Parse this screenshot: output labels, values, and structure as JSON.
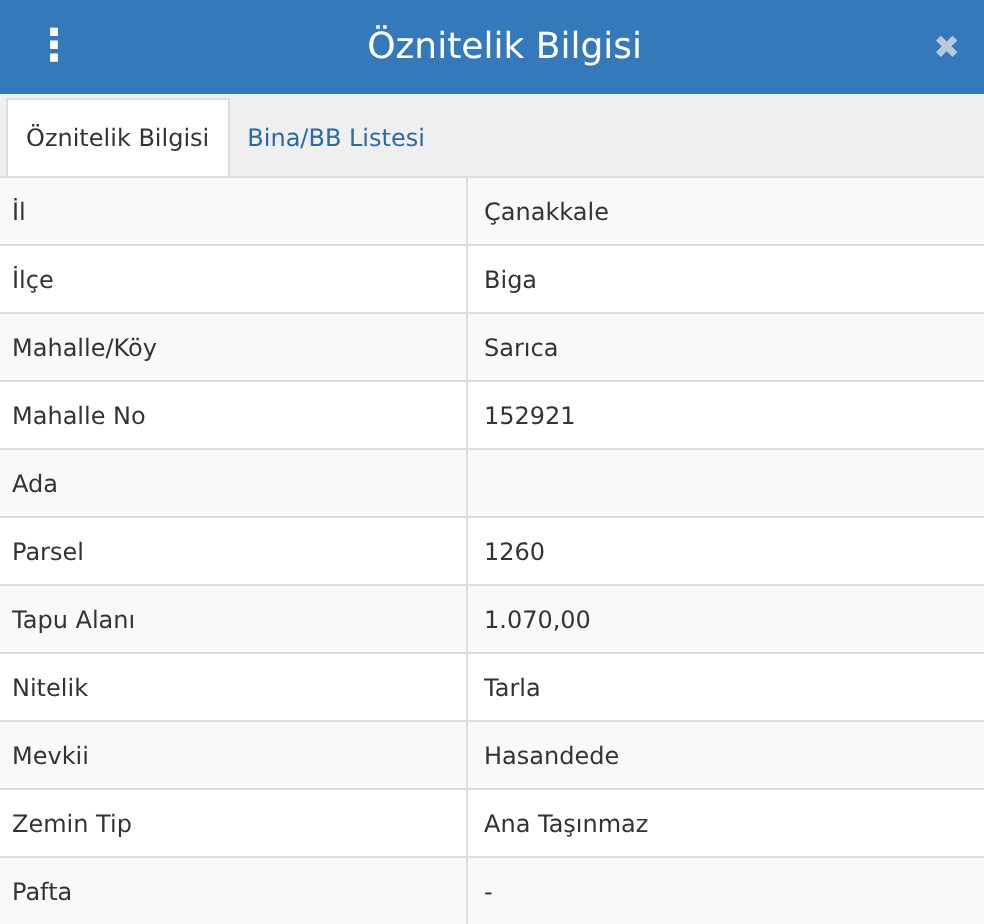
{
  "header": {
    "menu_glyph": "⋮",
    "title": "Öznitelik Bilgisi",
    "close_glyph": "✖"
  },
  "tabs": [
    {
      "label": "Öznitelik Bilgisi",
      "selected": true
    },
    {
      "label": "Bina/BB Listesi",
      "selected": false
    }
  ],
  "table": {
    "rows": [
      {
        "label": "İl",
        "value": "Çanakkale"
      },
      {
        "label": "İlçe",
        "value": "Biga"
      },
      {
        "label": "Mahalle/Köy",
        "value": "Sarıca"
      },
      {
        "label": "Mahalle No",
        "value": "152921"
      },
      {
        "label": "Ada"
      },
      {
        "label": "Parsel",
        "value": "1260"
      },
      {
        "label": "Tapu Alanı",
        "value": "1.070,00"
      },
      {
        "label": "Nitelik",
        "value": "Tarla"
      },
      {
        "label": "Mevkii",
        "value": "Hasandede"
      },
      {
        "label": "Zemin Tip",
        "value": "Ana Taşınmaz"
      },
      {
        "label": "Pafta",
        "value": "-"
      }
    ]
  }
}
